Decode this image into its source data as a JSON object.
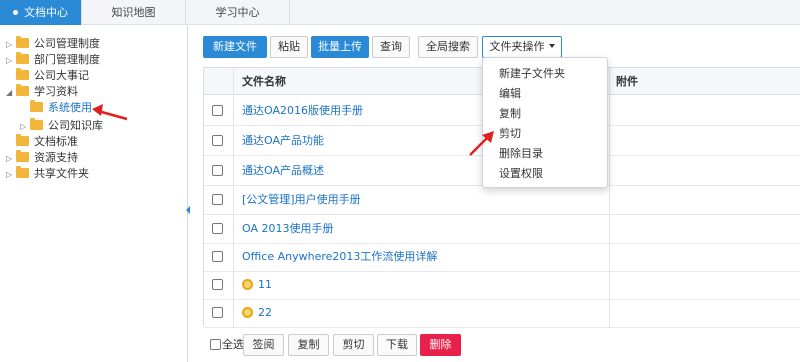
{
  "top_tabs": [
    "文档中心",
    "知识地图",
    "学习中心"
  ],
  "tree": [
    {
      "label": "公司管理制度",
      "expanded": false
    },
    {
      "label": "部门管理制度",
      "expanded": false
    },
    {
      "label": "公司大事记",
      "expanded": false
    },
    {
      "label": "学习资料",
      "expanded": true
    },
    {
      "label": "系统使用",
      "selected": true
    },
    {
      "label": "公司知识库",
      "expanded": false
    },
    {
      "label": "文档标准",
      "expanded": false
    },
    {
      "label": "资源支持",
      "expanded": false
    },
    {
      "label": "共享文件夹",
      "expanded": false
    }
  ],
  "toolbar": {
    "new_file": "新建文件",
    "paste": "粘贴",
    "batch_upload": "批量上传",
    "query": "查询",
    "global_search": "全局搜索",
    "folder_ops": "文件夹操作"
  },
  "table": {
    "col_name": "文件名称",
    "col_attach": "附件",
    "rows": [
      {
        "name": "通达OA2016版使用手册",
        "has_icon": false
      },
      {
        "name": "通达OA产品功能",
        "has_icon": false
      },
      {
        "name": "通达OA产品概述",
        "has_icon": false
      },
      {
        "name": "[公文管理]用户使用手册",
        "has_icon": false
      },
      {
        "name": "OA 2013使用手册",
        "has_icon": false
      },
      {
        "name": "Office Anywhere2013工作流使用详解",
        "has_icon": false
      },
      {
        "name": "11",
        "has_icon": true
      },
      {
        "name": "22",
        "has_icon": true
      }
    ]
  },
  "folder_menu": [
    "新建子文件夹",
    "编辑",
    "复制",
    "剪切",
    "删除目录",
    "设置权限"
  ],
  "bottom": {
    "select_all": "全选",
    "sign": "签阅",
    "copy": "复制",
    "cut": "剪切",
    "download": "下载",
    "delete": "删除"
  },
  "colors": {
    "accent": "#2a8ad6",
    "danger": "#e8214a",
    "link": "#1a73c8",
    "folder": "#f2b63a"
  }
}
